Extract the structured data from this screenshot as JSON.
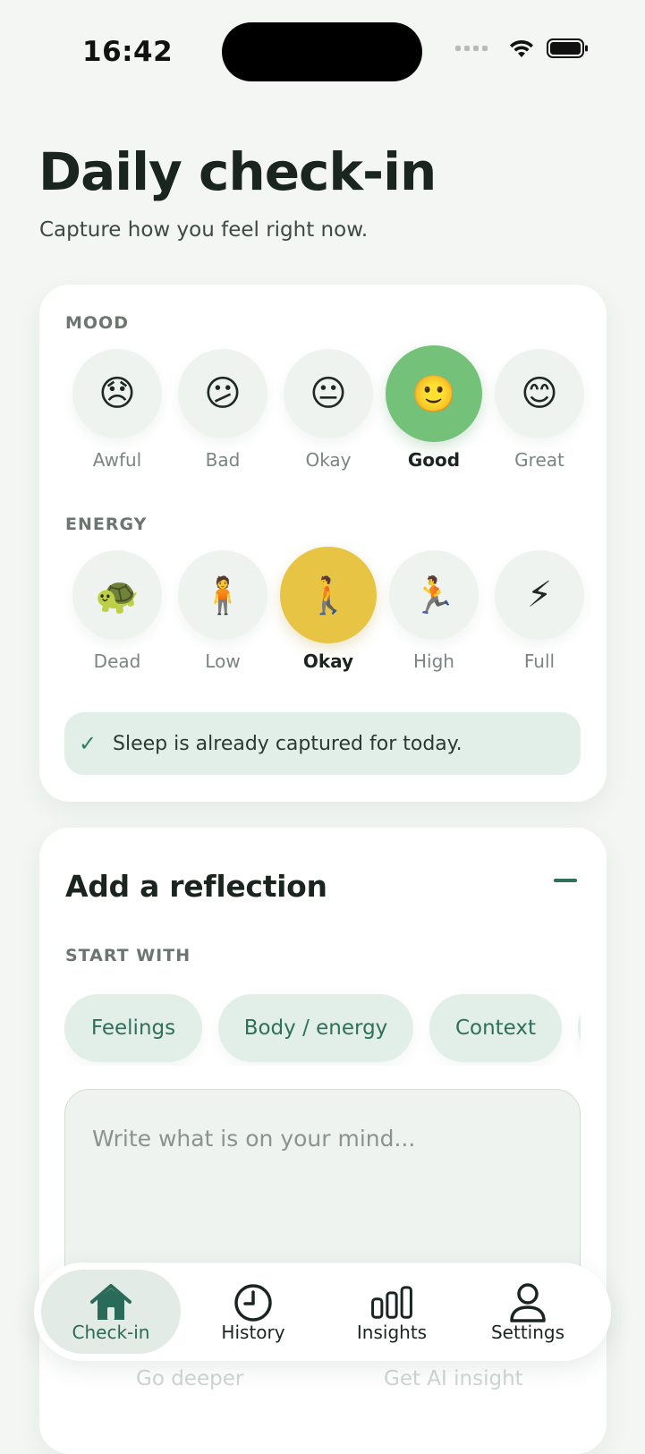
{
  "status_bar": {
    "time": "16:42"
  },
  "header": {
    "title": "Daily check-in",
    "subtitle": "Capture how you feel right now."
  },
  "mood": {
    "label": "MOOD",
    "selected": "Good",
    "options": [
      {
        "emoji": "😞",
        "label": "Awful"
      },
      {
        "emoji": "😕",
        "label": "Bad"
      },
      {
        "emoji": "😐",
        "label": "Okay"
      },
      {
        "emoji": "🙂",
        "label": "Good"
      },
      {
        "emoji": "😊",
        "label": "Great"
      }
    ]
  },
  "energy": {
    "label": "ENERGY",
    "selected": "Okay",
    "options": [
      {
        "emoji": "🐢",
        "label": "Dead"
      },
      {
        "emoji": "🧍",
        "label": "Low"
      },
      {
        "emoji": "🚶",
        "label": "Okay"
      },
      {
        "emoji": "🏃",
        "label": "High"
      },
      {
        "emoji": "⚡",
        "label": "Full"
      }
    ]
  },
  "sleep_notice": {
    "icon": "checkmark-icon",
    "check_glyph": "✓",
    "text": "Sleep is already captured for today."
  },
  "reflection": {
    "title": "Add a reflection",
    "start_with_label": "START WITH",
    "chips": [
      "Feelings",
      "Body / energy",
      "Context"
    ],
    "placeholder": "Write what is on your mind..."
  },
  "faded_actions": {
    "go_deeper": "Go deeper",
    "ai_insight": "Get AI insight"
  },
  "tab_bar": {
    "active": "Check-in",
    "tabs": [
      {
        "label": "Check-in",
        "icon": "home-icon"
      },
      {
        "label": "History",
        "icon": "clock-icon"
      },
      {
        "label": "Insights",
        "icon": "bar-chart-icon"
      },
      {
        "label": "Settings",
        "icon": "person-icon"
      }
    ]
  },
  "colors": {
    "mood_selected": "#74c17a",
    "energy_selected": "#e8c444",
    "accent": "#2f6f5c",
    "background": "#f3f6f3"
  }
}
